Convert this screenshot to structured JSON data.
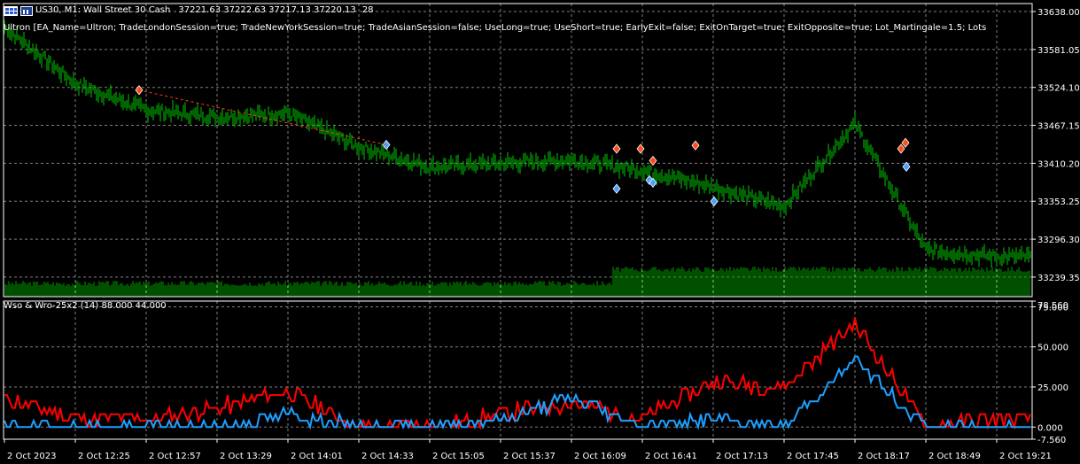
{
  "window": {
    "symbol": "US30, M1:",
    "description": "Wall Street 30 Cash",
    "ohlc": "37221.63 37222.63 37217.13 37220.13",
    "bars": "28",
    "ea_params": "Ultron [EA_Name=Ultron; TradeLondonSession=true; TradeNewYorkSession=true; TradeAsianSession=false; UseLong=true; UseShort=true; EarlyExit=false; ExitOnTarget=true; ExitOpposite=true; Lot_Martingale=1.5; Lots"
  },
  "indicator": {
    "label": "Wso & Wro-25x2 (14) 88.000 44.000"
  },
  "colors": {
    "background": "#000000",
    "grid": "#808080",
    "price": "#00c800",
    "volume": "#00a000",
    "wso": "#ff0000",
    "wro": "#1ea0ff",
    "sell_marker": "#ff4a1a",
    "buy_marker": "#4aa0ff"
  },
  "price_axis": [
    "33638.00",
    "33581.05",
    "33524.10",
    "33467.15",
    "33410.20",
    "33353.25",
    "33296.30",
    "33239.35"
  ],
  "indicator_axis": [
    "78.560",
    "75.000",
    "50.000",
    "25.000",
    "0.000",
    "-7.560"
  ],
  "time_axis": [
    "2 Oct 2023",
    "2 Oct 12:25",
    "2 Oct 12:57",
    "2 Oct 13:29",
    "2 Oct 14:01",
    "2 Oct 14:33",
    "2 Oct 15:05",
    "2 Oct 15:37",
    "2 Oct 16:09",
    "2 Oct 16:41",
    "2 Oct 17:13",
    "2 Oct 17:45",
    "2 Oct 18:17",
    "2 Oct 18:49",
    "2 Oct 19:21"
  ],
  "chart_data": [
    {
      "type": "line",
      "title": "US30, M1: Wall Street 30 Cash",
      "ylim": [
        33210,
        33650
      ],
      "x": [
        "2 Oct 2023",
        "2 Oct 12:25",
        "2 Oct 12:57",
        "2 Oct 13:29",
        "2 Oct 14:01",
        "2 Oct 14:33",
        "2 Oct 15:05",
        "2 Oct 15:37",
        "2 Oct 16:09",
        "2 Oct 16:41",
        "2 Oct 17:13",
        "2 Oct 17:45",
        "2 Oct 18:17",
        "2 Oct 18:49",
        "2 Oct 19:21"
      ],
      "series": [
        {
          "name": "price",
          "values": [
            33615,
            33530,
            33490,
            33480,
            33485,
            33435,
            33405,
            33410,
            33415,
            33400,
            33375,
            33345,
            33470,
            33280,
            33270
          ]
        }
      ]
    },
    {
      "type": "line",
      "title": "Wso & Wro-25x2 (14) 88.000 44.000",
      "ylim": [
        -7.56,
        78.56
      ],
      "x": [
        "2 Oct 2023",
        "2 Oct 12:25",
        "2 Oct 12:57",
        "2 Oct 13:29",
        "2 Oct 14:01",
        "2 Oct 14:33",
        "2 Oct 15:05",
        "2 Oct 15:37",
        "2 Oct 16:09",
        "2 Oct 16:41",
        "2 Oct 17:13",
        "2 Oct 17:45",
        "2 Oct 18:17",
        "2 Oct 18:49",
        "2 Oct 19:21"
      ],
      "series": [
        {
          "name": "Wso",
          "values": [
            18,
            5,
            5,
            12,
            22,
            0,
            0,
            8,
            15,
            5,
            28,
            25,
            65,
            0,
            5
          ]
        },
        {
          "name": "Wro",
          "values": [
            0,
            0,
            0,
            0,
            8,
            0,
            0,
            5,
            18,
            0,
            5,
            0,
            42,
            0,
            0
          ]
        }
      ]
    }
  ]
}
